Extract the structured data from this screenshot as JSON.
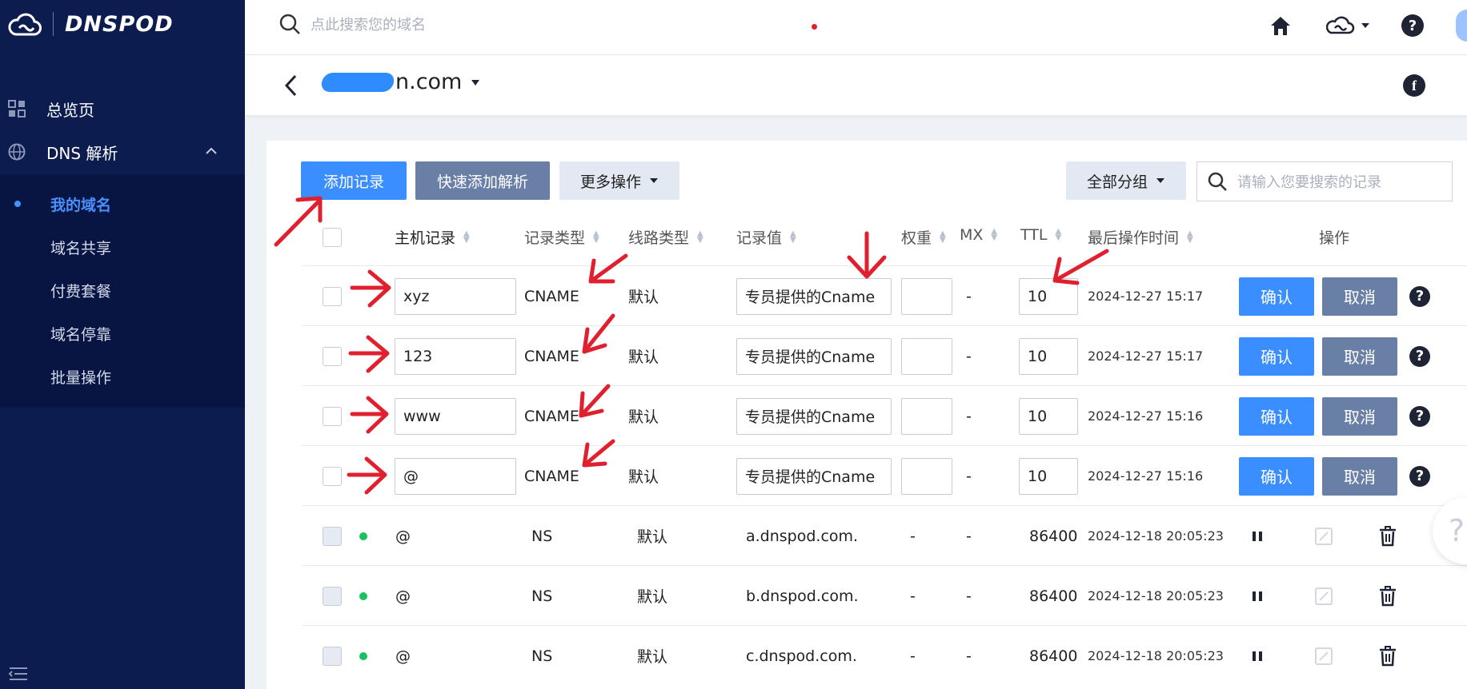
{
  "brand": {
    "logo_text": "DNSPOD"
  },
  "sidebar": {
    "items": [
      {
        "label": "总览页",
        "icon": "grid-icon"
      },
      {
        "label": "DNS 解析",
        "icon": "globe-icon"
      }
    ],
    "sub_items": [
      {
        "label": "我的域名",
        "active": true
      },
      {
        "label": "域名共享"
      },
      {
        "label": "付费套餐"
      },
      {
        "label": "域名停靠"
      },
      {
        "label": "批量操作"
      }
    ]
  },
  "topbar": {
    "search_placeholder": "点此搜索您的域名"
  },
  "domain": {
    "title_suffix": "n.com"
  },
  "toolbar": {
    "add_record": "添加记录",
    "quick_add": "快速添加解析",
    "more_ops": "更多操作",
    "all_groups": "全部分组",
    "search_placeholder": "请输入您要搜索的记录"
  },
  "table": {
    "headers": {
      "host": "主机记录",
      "type": "记录类型",
      "line": "线路类型",
      "value": "记录值",
      "weight": "权重",
      "mx": "MX",
      "ttl": "TTL",
      "last_time": "最后操作时间",
      "actions": "操作"
    },
    "edit_rows": [
      {
        "host": "xyz",
        "type": "CNAME",
        "line": "默认",
        "value": "专员提供的Cname",
        "mx": "-",
        "ttl": "10",
        "time": "2024-12-27 15:17",
        "confirm": "确认",
        "cancel": "取消"
      },
      {
        "host": "123",
        "type": "CNAME",
        "line": "默认",
        "value": "专员提供的Cname",
        "mx": "-",
        "ttl": "10",
        "time": "2024-12-27 15:17",
        "confirm": "确认",
        "cancel": "取消"
      },
      {
        "host": "www",
        "type": "CNAME",
        "line": "默认",
        "value": "专员提供的Cname",
        "mx": "-",
        "ttl": "10",
        "time": "2024-12-27 15:16",
        "confirm": "确认",
        "cancel": "取消"
      },
      {
        "host": "@",
        "type": "CNAME",
        "line": "默认",
        "value": "专员提供的Cname",
        "mx": "-",
        "ttl": "10",
        "time": "2024-12-27 15:16",
        "confirm": "确认",
        "cancel": "取消"
      }
    ],
    "ns_rows": [
      {
        "host": "@",
        "type": "NS",
        "line": "默认",
        "value": "a.dnspod.com.",
        "weight": "-",
        "mx": "-",
        "ttl": "86400",
        "time": "2024-12-18 20:05:23"
      },
      {
        "host": "@",
        "type": "NS",
        "line": "默认",
        "value": "b.dnspod.com.",
        "weight": "-",
        "mx": "-",
        "ttl": "86400",
        "time": "2024-12-18 20:05:23"
      },
      {
        "host": "@",
        "type": "NS",
        "line": "默认",
        "value": "c.dnspod.com.",
        "weight": "-",
        "mx": "-",
        "ttl": "86400",
        "time": "2024-12-18 20:05:23"
      }
    ]
  },
  "colors": {
    "sidebar": "#0c1c4f",
    "primary": "#3a8eff",
    "annotation": "#e0202f"
  }
}
